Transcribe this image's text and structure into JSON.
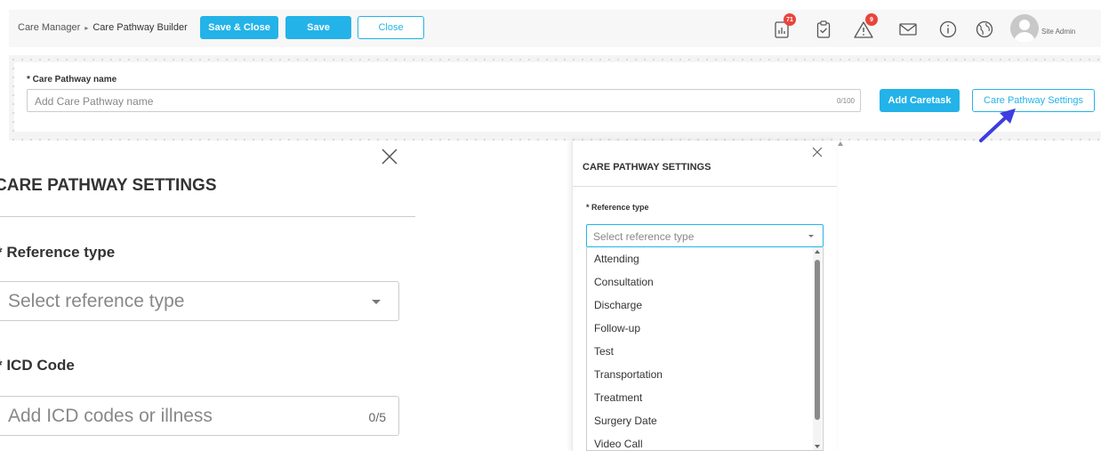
{
  "header": {
    "breadcrumb": [
      "Care Manager",
      "Care Pathway Builder"
    ],
    "breadcrumb_separator": "▸",
    "save_close_label": "Save & Close",
    "save_label": "Save",
    "close_label": "Close",
    "icons": [
      {
        "name": "reports-icon",
        "badge": "71"
      },
      {
        "name": "clipboard-check-icon",
        "badge": ""
      },
      {
        "name": "alert-icon",
        "badge": "9"
      },
      {
        "name": "mail-icon",
        "badge": ""
      },
      {
        "name": "info-icon",
        "badge": ""
      },
      {
        "name": "globe-icon",
        "badge": ""
      }
    ],
    "user_role": "Site Admin"
  },
  "builder": {
    "name_label": "* Care Pathway name",
    "name_placeholder": "Add Care Pathway name",
    "name_counter": "0/100",
    "add_caretask_label": "Add Caretask",
    "settings_button_label": "Care Pathway Settings"
  },
  "zoomed_settings": {
    "title": "CARE PATHWAY SETTINGS",
    "reference_type_label": "* Reference type",
    "reference_type_placeholder": "Select reference type",
    "icd_label": "* ICD Code",
    "icd_placeholder": "Add ICD codes or illness",
    "icd_counter": "0/5"
  },
  "settings_panel": {
    "title": "CARE PATHWAY SETTINGS",
    "reference_type_label": "* Reference type",
    "reference_type_placeholder": "Select reference type",
    "options": [
      "Attending",
      "Consultation",
      "Discharge",
      "Follow-up",
      "Test",
      "Transportation",
      "Treatment",
      "Surgery Date",
      "Video Call"
    ]
  },
  "colors": {
    "accent": "#23b3e8",
    "badge": "#e8453c",
    "annotation_arrow": "#3d3de0"
  }
}
